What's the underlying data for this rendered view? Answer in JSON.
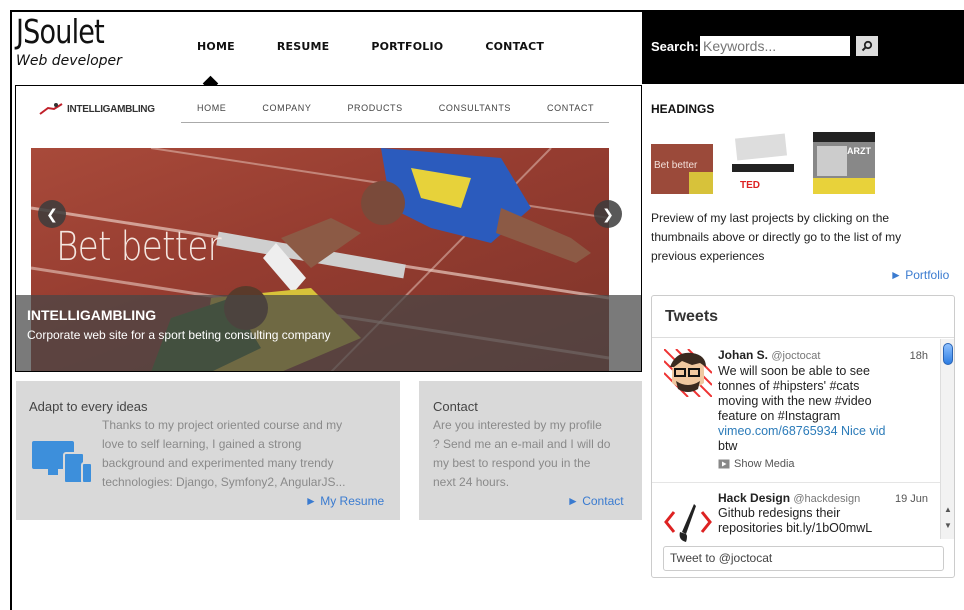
{
  "site": {
    "title": "JSoulet",
    "subtitle": "Web developer"
  },
  "nav": {
    "home": "HOME",
    "resume": "RESUME",
    "portfolio": "PORTFOLIO",
    "contact": "CONTACT"
  },
  "search": {
    "label": "Search:",
    "placeholder": "Keywords...",
    "button_icon": "magnifier-icon"
  },
  "slider": {
    "inner_logo_text": "INTELLIGAMBLING",
    "inner_nav": [
      "HOME",
      "COMPANY",
      "PRODUCTS",
      "CONSULTANTS",
      "CONTACT"
    ],
    "banner_text": "Bet better",
    "caption_title": "INTELLIGAMBLING",
    "caption_text": "Corporate web site for a sport beting consulting company",
    "prev_icon": "chevron-left-icon",
    "next_icon": "chevron-right-icon"
  },
  "box_adapt": {
    "title": "Adapt to every ideas",
    "text_lines": [
      "Thanks to my project oriented course and my",
      "love to self learning, I gained a strong",
      "background and experimented many trendy",
      "technologies: Django, Symfony2, AngularJS..."
    ],
    "link": "My Resume",
    "icon": "devices-icon"
  },
  "box_contact": {
    "title": "Contact",
    "text_lines": [
      "Are you interested by my profile",
      "? Send me an e-mail and I will do",
      "my best to respond you in the",
      "next 24 hours."
    ],
    "link": "Contact"
  },
  "sidebar": {
    "headings": "HEADINGS",
    "preview_text": "Preview of my last projects by clicking on the thumbnails above or directly go to the list of my previous experiences",
    "portfolio_link": "Portfolio",
    "thumb_texts": [
      "Bet better",
      "TED",
      "ARZT"
    ]
  },
  "tweets": {
    "title": "Tweets",
    "items": [
      {
        "name": "Johan S.",
        "handle": "@joctocat",
        "time": "18h",
        "lines": [
          "We will soon be able to see",
          "tonnes of #hipsters' #cats",
          "moving with the new #video",
          "feature on #Instagram",
          " vimeo.com/68765934 Nice vid",
          "btw"
        ],
        "media": "Show Media"
      },
      {
        "name": "Hack Design",
        "handle": "@hackdesign",
        "time": "19 Jun",
        "lines": [
          "Github redesigns their",
          "repositories bit.ly/1bO0mwL"
        ]
      }
    ],
    "input_placeholder": "Tweet to @joctocat"
  },
  "colors": {
    "link": "#3a7bd0",
    "box_bg": "#d9d9d9",
    "header_black": "#000000",
    "tweet_link": "#2b7bb9"
  }
}
